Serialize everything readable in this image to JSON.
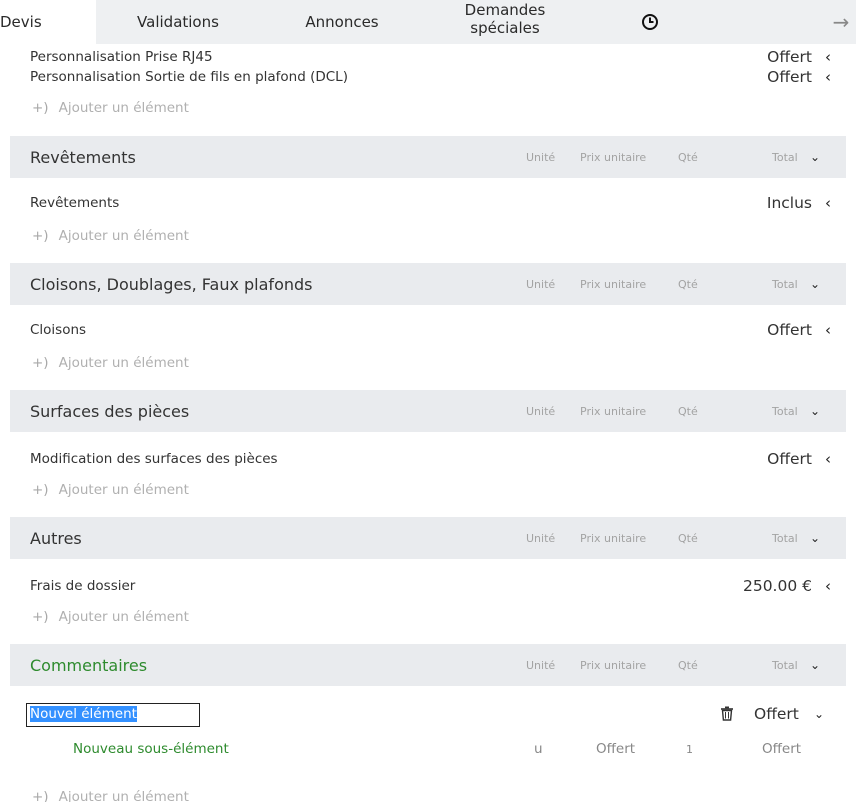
{
  "tabs": {
    "devis": "Devis",
    "validations": "Validations",
    "annonces": "Annonces",
    "demandes_line1": "Demandes",
    "demandes_line2": "spéciales",
    "history_icon": "clock-icon",
    "next_icon": "arrow-right-icon",
    "next_glyph": "→"
  },
  "columns": {
    "unite": "Unité",
    "prix": "Prix unitaire",
    "qte": "Qté",
    "total": "Total"
  },
  "add_label": "Ajouter un élément",
  "add_glyph": "+)",
  "chevron_left": "‹",
  "chevron_down": "⌄",
  "top_items": [
    {
      "name": "Personnalisation Prise RJ45",
      "value": "Offert"
    },
    {
      "name": "Personnalisation Sortie de fils en plafond (DCL)",
      "value": "Offert"
    }
  ],
  "sections": [
    {
      "title": "Revêtements",
      "items": [
        {
          "name": "Revêtements",
          "value": "Inclus"
        }
      ]
    },
    {
      "title": "Cloisons, Doublages, Faux plafonds",
      "items": [
        {
          "name": "Cloisons",
          "value": "Offert"
        }
      ]
    },
    {
      "title": "Surfaces des pièces",
      "items": [
        {
          "name": "Modification des surfaces des pièces",
          "value": "Offert"
        }
      ]
    },
    {
      "title": "Autres",
      "items": [
        {
          "name": "Frais de dossier",
          "value": "250.00 €"
        }
      ]
    },
    {
      "title": "Commentaires"
    }
  ],
  "commentaires": {
    "edit_value": "Nouvel élément",
    "value": "Offert",
    "trash_icon": "trash-icon",
    "sub": {
      "name": "Nouveau sous-élément",
      "unit": "u",
      "price": "Offert",
      "qty": "1",
      "total": "Offert"
    }
  },
  "colors": {
    "section_bg": "#e9ebee",
    "green": "#2e8b2e",
    "selection": "#3390ff"
  }
}
